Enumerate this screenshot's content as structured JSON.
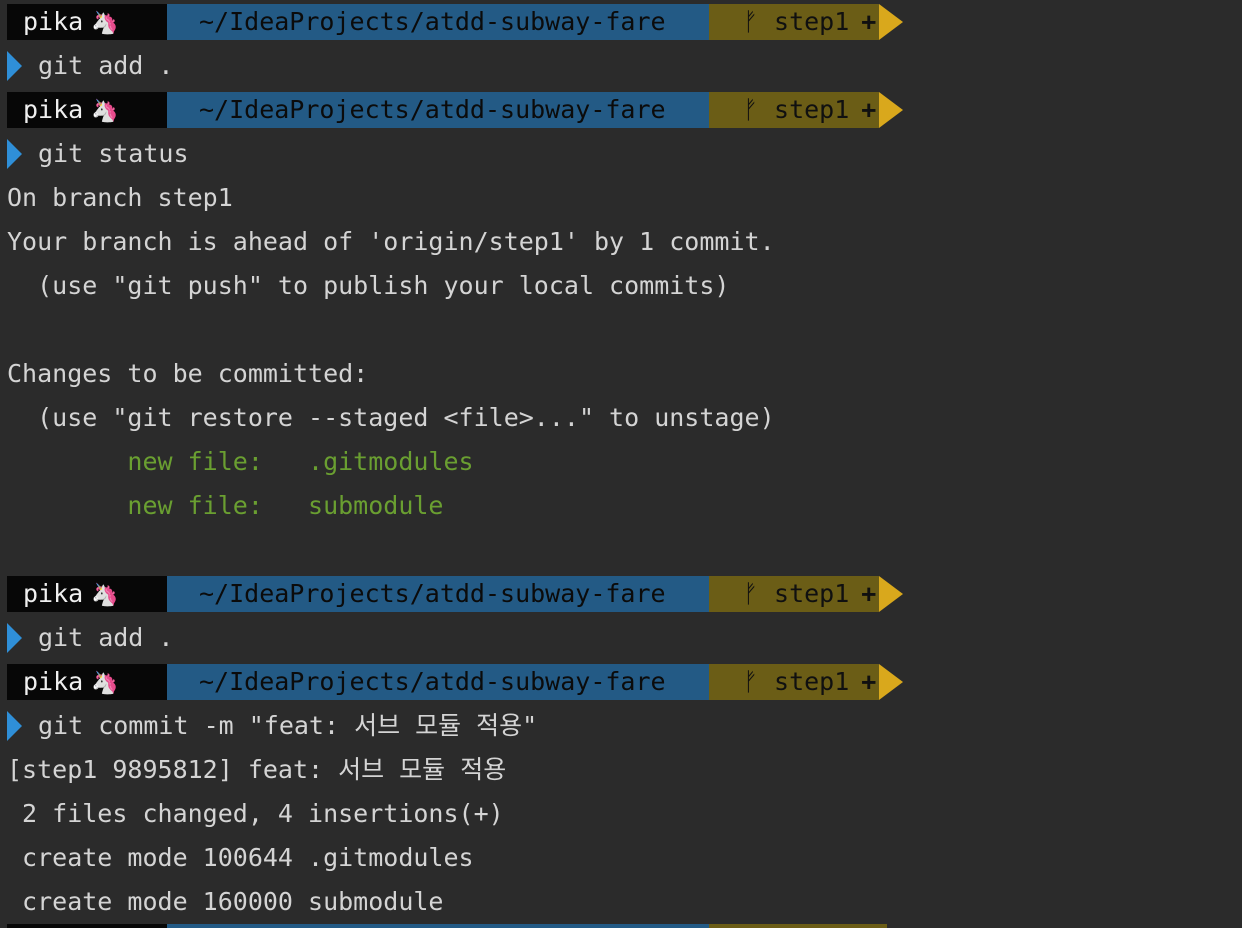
{
  "prompt": {
    "user": "pika",
    "emoji": "🦄",
    "dir": "~/IdeaProjects/atdd-subway-fare",
    "branch_icon": "ᚠ",
    "branch": "step1",
    "dirty": "+"
  },
  "lines": {
    "cmd1": "git add .",
    "cmd2": "git status",
    "out_branch": "On branch step1",
    "out_ahead": "Your branch is ahead of 'origin/step1' by 1 commit.",
    "out_push_hint": "  (use \"git push\" to publish your local commits)",
    "out_changes": "Changes to be committed:",
    "out_restore_hint": "  (use \"git restore --staged <file>...\" to unstage)",
    "out_new_file_1": "        new file:   .gitmodules",
    "out_new_file_2": "        new file:   submodule",
    "cmd3": "git add .",
    "cmd4": "git commit -m \"feat: 서브 모듈 적용\"",
    "out_commit": "[step1 9895812] feat: 서브 모듈 적용",
    "out_stats": " 2 files changed, 4 insertions(+)",
    "out_create_1": " create mode 100644 .gitmodules",
    "out_create_2": " create mode 160000 submodule"
  },
  "colors": {
    "background": "#2b2b2b",
    "text": "#d4d4d4",
    "user_segment": "#070707",
    "dir_segment": "#235a85",
    "dir_arrow": "#2f86c9",
    "branch_segment": "#6b5d16",
    "branch_arrow": "#d9a81c",
    "chevron": "#2f8fd8",
    "new_file_text": "#6a9f31"
  }
}
